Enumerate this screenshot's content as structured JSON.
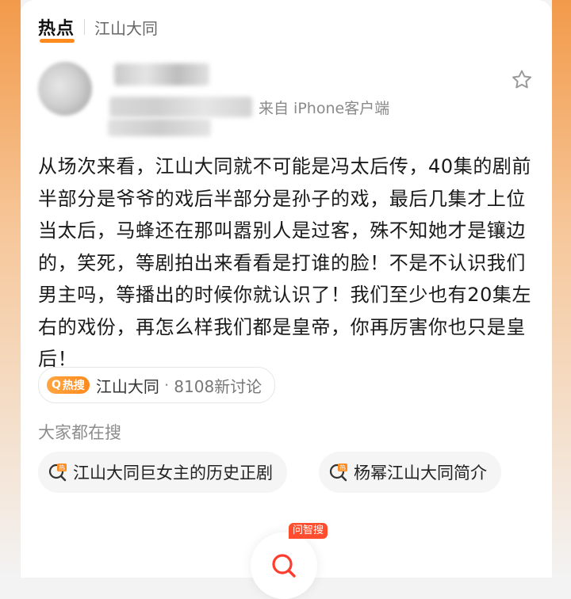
{
  "header": {
    "title": "热点",
    "topic": "江山大同"
  },
  "post": {
    "client_text": "来自 iPhone客户端",
    "body": "从场次来看，江山大同就不可能是冯太后传，40集的剧前半部分是爷爷的戏后半部分是孙子的戏，最后几集才上位当太后，马蜂还在那叫嚣别人是过客，殊不知她才是镶边的，笑死，等剧拍出来看看是打谁的脸！不是不认识我们男主吗，等播出的时候你就认识了！我们至少也有20集左右的戏份，再怎么样我们都是皇帝，你再厉害你也只是皇后！"
  },
  "topic_pill": {
    "badge": "热搜",
    "topic": "江山大同",
    "separator": "·",
    "count": "8108新讨论"
  },
  "search": {
    "heading": "大家都在搜",
    "suggestions": [
      {
        "icon": "hot-search-icon",
        "label": "江山大同巨女主的历史正剧"
      },
      {
        "icon": "hot-search-icon",
        "label": "杨幂江山大同简介"
      }
    ]
  },
  "fab": {
    "badge": "问智搜",
    "icon": "search-icon"
  },
  "colors": {
    "accent": "#ff8a1e",
    "badge_red": "#ff4d2e",
    "text": "#1a1a1a",
    "muted": "#8c8c8c"
  }
}
